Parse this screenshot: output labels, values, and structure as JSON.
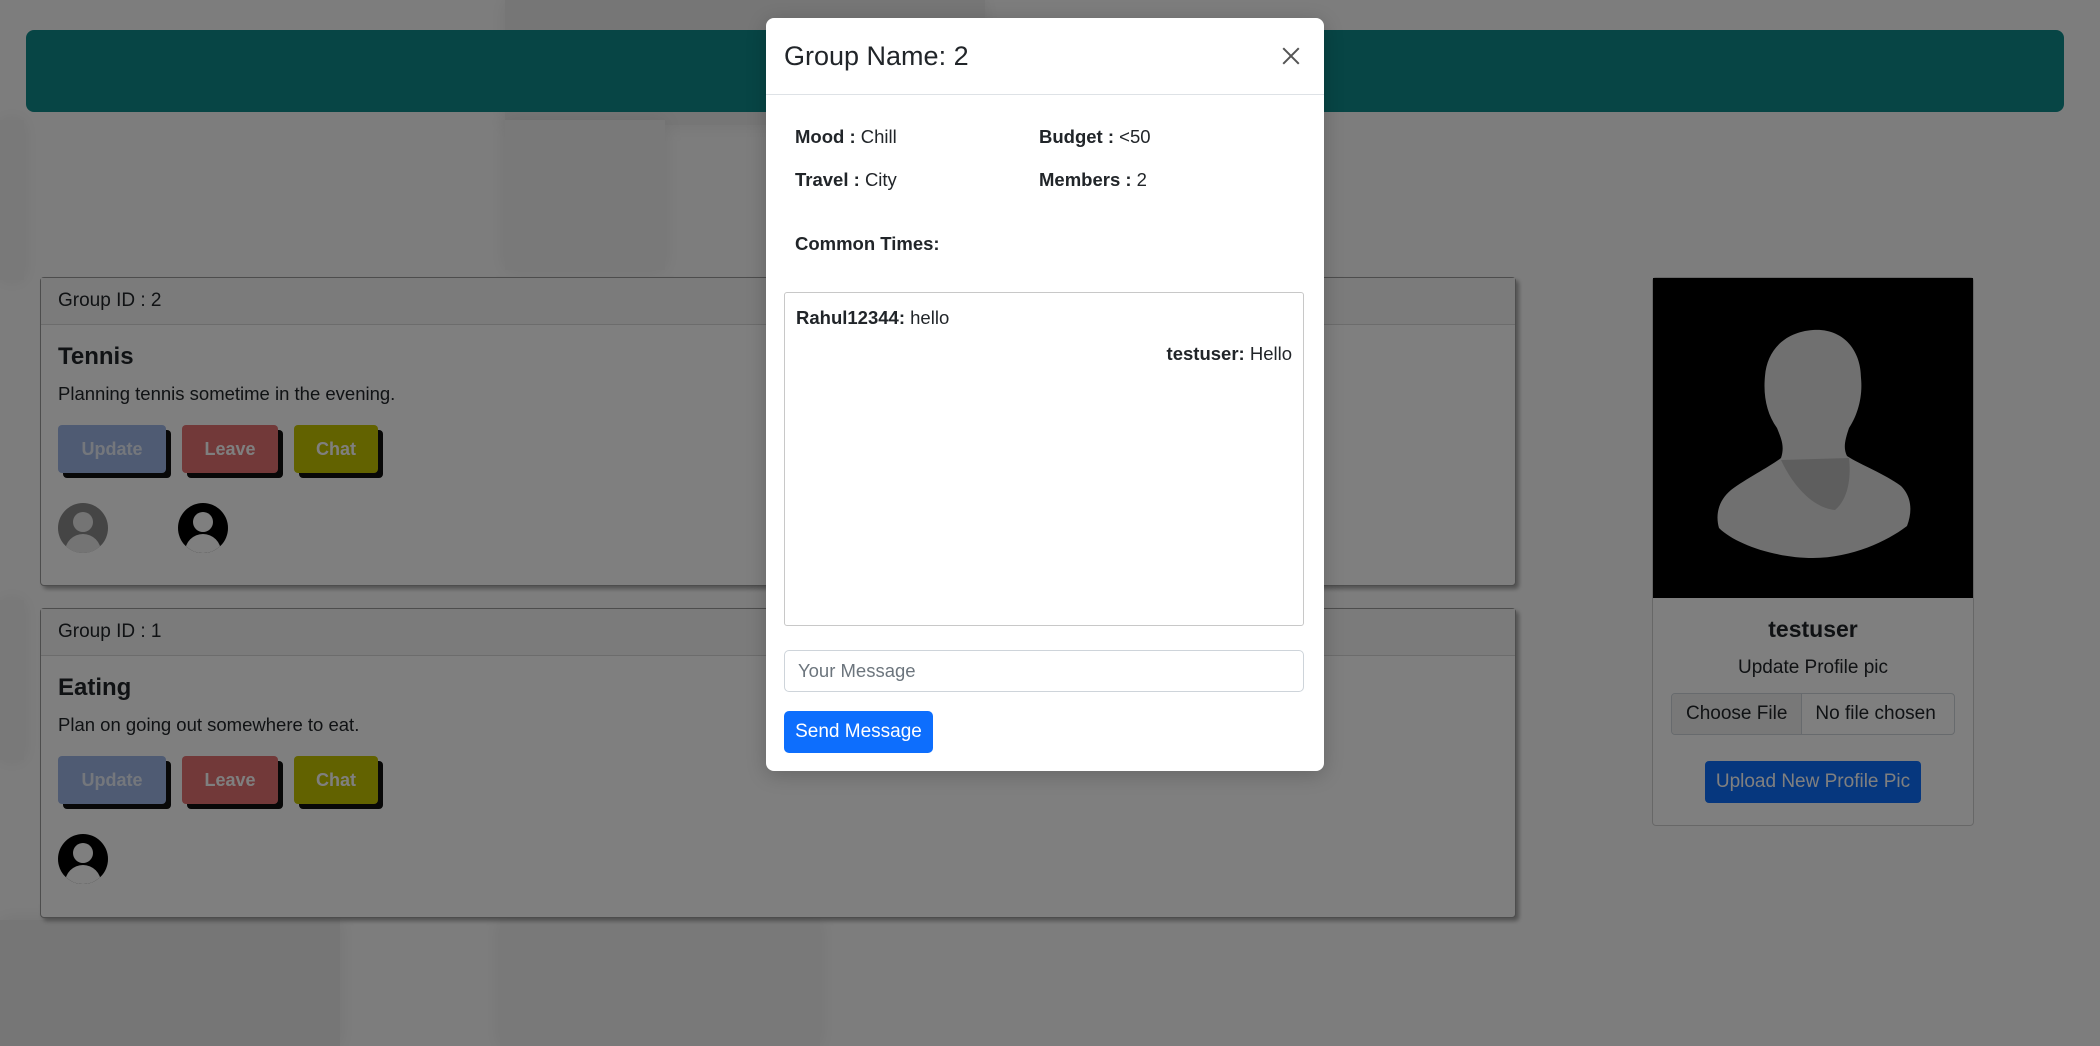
{
  "groups": [
    {
      "id_label": "Group ID : 2",
      "title": "Tennis",
      "description": "Planning tennis sometime in the evening.",
      "buttons": {
        "update": "Update",
        "leave": "Leave",
        "chat": "Chat"
      }
    },
    {
      "id_label": "Group ID : 1",
      "title": "Eating",
      "description": "Plan on going out somewhere to eat.",
      "buttons": {
        "update": "Update",
        "leave": "Leave",
        "chat": "Chat"
      }
    }
  ],
  "profile": {
    "username": "testuser",
    "update_label": "Update Profile pic",
    "choose_file": "Choose File",
    "no_file": "No file chosen",
    "upload_button": "Upload New Profile Pic"
  },
  "modal": {
    "title": "Group Name: 2",
    "info": {
      "mood_label": "Mood :",
      "mood_value": "Chill",
      "budget_label": "Budget :",
      "budget_value": "<50",
      "travel_label": "Travel :",
      "travel_value": "City",
      "members_label": "Members :",
      "members_value": "2"
    },
    "common_times_label": "Common Times:",
    "messages": [
      {
        "user": "Rahul12344:",
        "text": "hello",
        "align": "left"
      },
      {
        "user": "testuser:",
        "text": "Hello",
        "align": "right"
      }
    ],
    "message_placeholder": "Your Message",
    "send_button": "Send Message"
  },
  "colors": {
    "topbar": "#0e8a8a",
    "primary": "#0d6efd",
    "leave": "#e57373",
    "chat": "#c4c400",
    "update": "#9fb7e6"
  }
}
